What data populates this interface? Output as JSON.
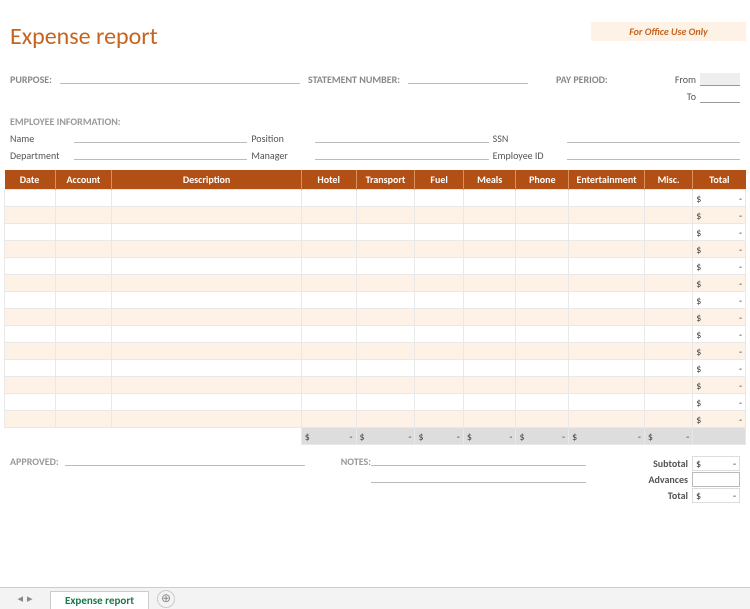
{
  "office_banner": "For Office Use Only",
  "title": "Expense report",
  "meta": {
    "purpose_label": "PURPOSE:",
    "statement_label": "STATEMENT NUMBER:",
    "pay_period_label": "PAY PERIOD:",
    "from_label": "From",
    "to_label": "To"
  },
  "employee": {
    "heading": "EMPLOYEE INFORMATION:",
    "name_label": "Name",
    "position_label": "Position",
    "ssn_label": "SSN",
    "department_label": "Department",
    "manager_label": "Manager",
    "employee_id_label": "Employee ID"
  },
  "columns": [
    "Date",
    "Account",
    "Description",
    "Hotel",
    "Transport",
    "Fuel",
    "Meals",
    "Phone",
    "Entertainment",
    "Misc.",
    "Total"
  ],
  "row_count": 14,
  "row_total_display": {
    "currency": "$",
    "value": "-"
  },
  "column_sums": [
    {
      "currency": "$",
      "value": "-"
    },
    {
      "currency": "$",
      "value": "-"
    },
    {
      "currency": "$",
      "value": "-"
    },
    {
      "currency": "$",
      "value": "-"
    },
    {
      "currency": "$",
      "value": "-"
    },
    {
      "currency": "$",
      "value": "-"
    },
    {
      "currency": "$",
      "value": "-"
    }
  ],
  "footer": {
    "approved_label": "APPROVED:",
    "notes_label": "NOTES:"
  },
  "summary": {
    "subtotal_label": "Subtotal",
    "advances_label": "Advances",
    "total_label": "Total",
    "subtotal": {
      "currency": "$",
      "value": "-"
    },
    "advances": {
      "currency": "",
      "value": ""
    },
    "total": {
      "currency": "$",
      "value": "-"
    }
  },
  "sheet_tab": "Expense report",
  "add_sheet_glyph": "⊕",
  "nav_prev": "◂",
  "nav_next": "▸"
}
